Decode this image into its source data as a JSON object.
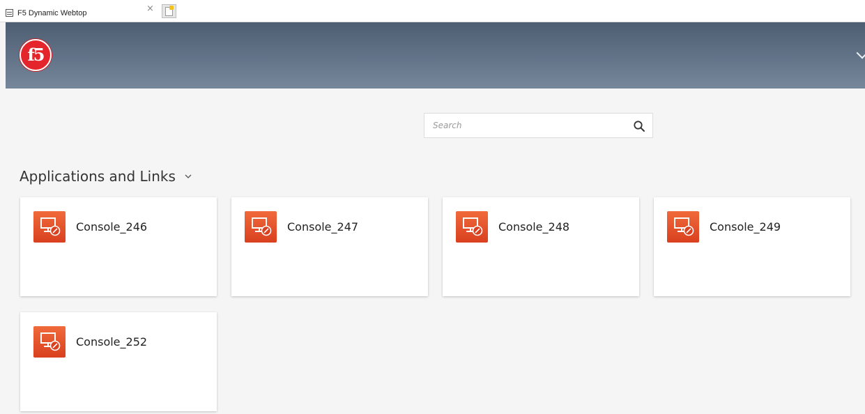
{
  "browser": {
    "tab_title": "F5 Dynamic Webtop",
    "tab_close": "×",
    "new_tab_icon": "new-tab-icon"
  },
  "header": {
    "logo_text": "f5",
    "brand_color": "#e5252c",
    "menu_icon": "chevron-down-icon"
  },
  "search": {
    "placeholder": "Search",
    "value": "",
    "icon": "search-icon"
  },
  "section": {
    "title": "Applications and Links",
    "toggle_icon": "chevron-down-icon"
  },
  "apps": [
    {
      "label": "Console_246",
      "icon": "remote-desktop-icon"
    },
    {
      "label": "Console_247",
      "icon": "remote-desktop-icon"
    },
    {
      "label": "Console_248",
      "icon": "remote-desktop-icon"
    },
    {
      "label": "Console_249",
      "icon": "remote-desktop-icon"
    },
    {
      "label": "Console_252",
      "icon": "remote-desktop-icon"
    }
  ]
}
